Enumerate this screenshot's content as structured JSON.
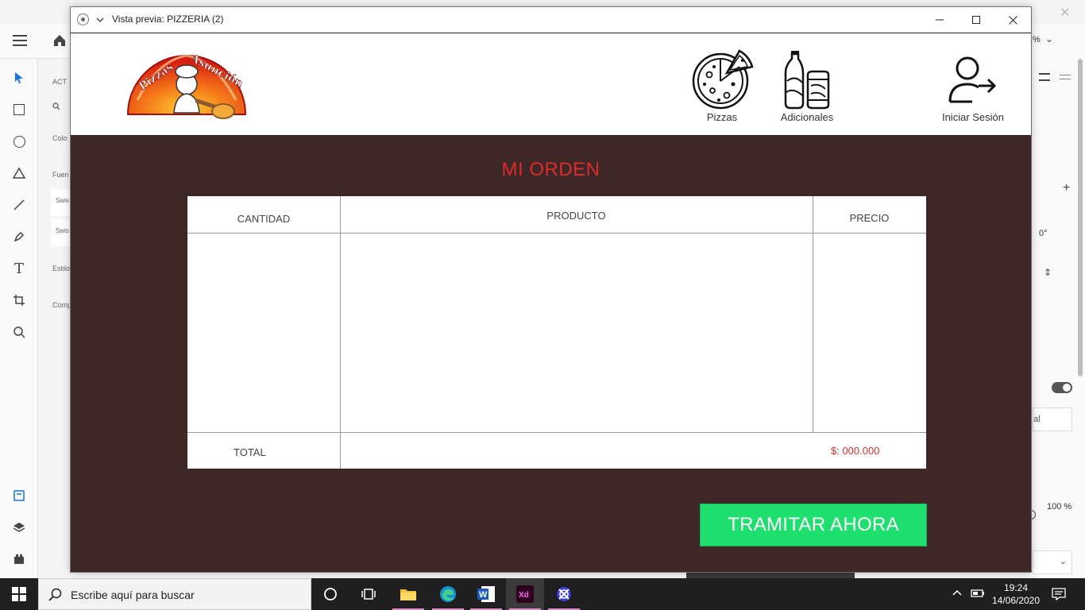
{
  "window": {
    "title": "Vista previa: PIZZERIA (2)"
  },
  "nav": {
    "items": [
      {
        "label": "Pizzas",
        "icon": "pizza-icon"
      },
      {
        "label": "Adicionales",
        "icon": "drinks-icon"
      },
      {
        "label": "Iniciar Sesión",
        "icon": "user-login-icon"
      }
    ]
  },
  "order": {
    "title": "MI ORDEN",
    "columns": [
      "CANTIDAD",
      "PRODUCTO",
      "PRECIO"
    ],
    "total_label": "TOTAL",
    "total_value": "$: 000.000",
    "checkout_label": "TRAMITAR AHORA"
  },
  "xd": {
    "panel_labels": [
      "ACT",
      "Colo",
      "Fuen",
      "Swis",
      "Swis",
      "Estilo",
      "Comp"
    ],
    "right_values": [
      "%",
      "0°",
      "al",
      "100 %"
    ]
  },
  "taskbar": {
    "search_placeholder": "Escribe aquí para buscar",
    "time": "19:24",
    "date": "14/06/2020"
  },
  "colors": {
    "header_bg": "#ffffff",
    "main_bg": "#3d2727",
    "title_red": "#e02b2b",
    "total_red": "#d03030",
    "button_green": "#1fe06e"
  }
}
